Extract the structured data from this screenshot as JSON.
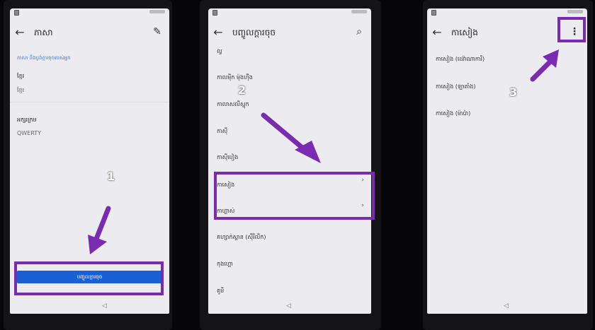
{
  "panel1": {
    "title": "ភាសា",
    "back_icon": "arrow-left-icon",
    "edit_icon": "pencil-icon",
    "section_heading": "ភាសា និងប្លង់ក្ដារចុចរបស់អ្នក",
    "language_label": "ខ្មែរ",
    "language_value": "ខ្មែរ",
    "keyboard_label": "អក្សរក្រម",
    "keyboard_value": "QWERTY",
    "primary_button": "បញ្ចូលក្ដារចុច",
    "step_number": "1"
  },
  "panel2": {
    "title": "បញ្ចូលក្ដារចុច",
    "search_icon": "search-icon",
    "items": [
      {
        "label": "ល្វ"
      },
      {
        "label": "កាលម៉ីក ម៉ុងហ៊ឹង"
      },
      {
        "label": "កាលាសលីស្ហុក"
      },
      {
        "label": "កាស៊ី"
      },
      {
        "label": "កាស៊ីបៀង"
      },
      {
        "label": "កាសៀង",
        "chevron": "›"
      },
      {
        "label": "កាហ្គាស់",
        "chevron": "›"
      },
      {
        "label": "គហ្សាក់ស្តាន (ស៊ីរីលីក)"
      },
      {
        "label": "កុងហ្គោ"
      },
      {
        "label": "គូមី"
      }
    ],
    "step_number": "2"
  },
  "panel3": {
    "title": "កាសៀង",
    "more_icon": "more-vertical-icon",
    "more_glyph": "⋮",
    "items": [
      {
        "label": "កាសៀង (ដេវ៉ាណាការី)"
      },
      {
        "label": "កាសៀង (ឡាតាំង)"
      },
      {
        "label": "កាសៀង (ម៉ាប៉ា)"
      }
    ],
    "step_number": "3"
  },
  "nav_back_glyph": "◁",
  "colors": {
    "accent_purple": "#7a2cb0",
    "button_blue": "#1a5fd4",
    "section_blue": "#3e7ad8"
  }
}
